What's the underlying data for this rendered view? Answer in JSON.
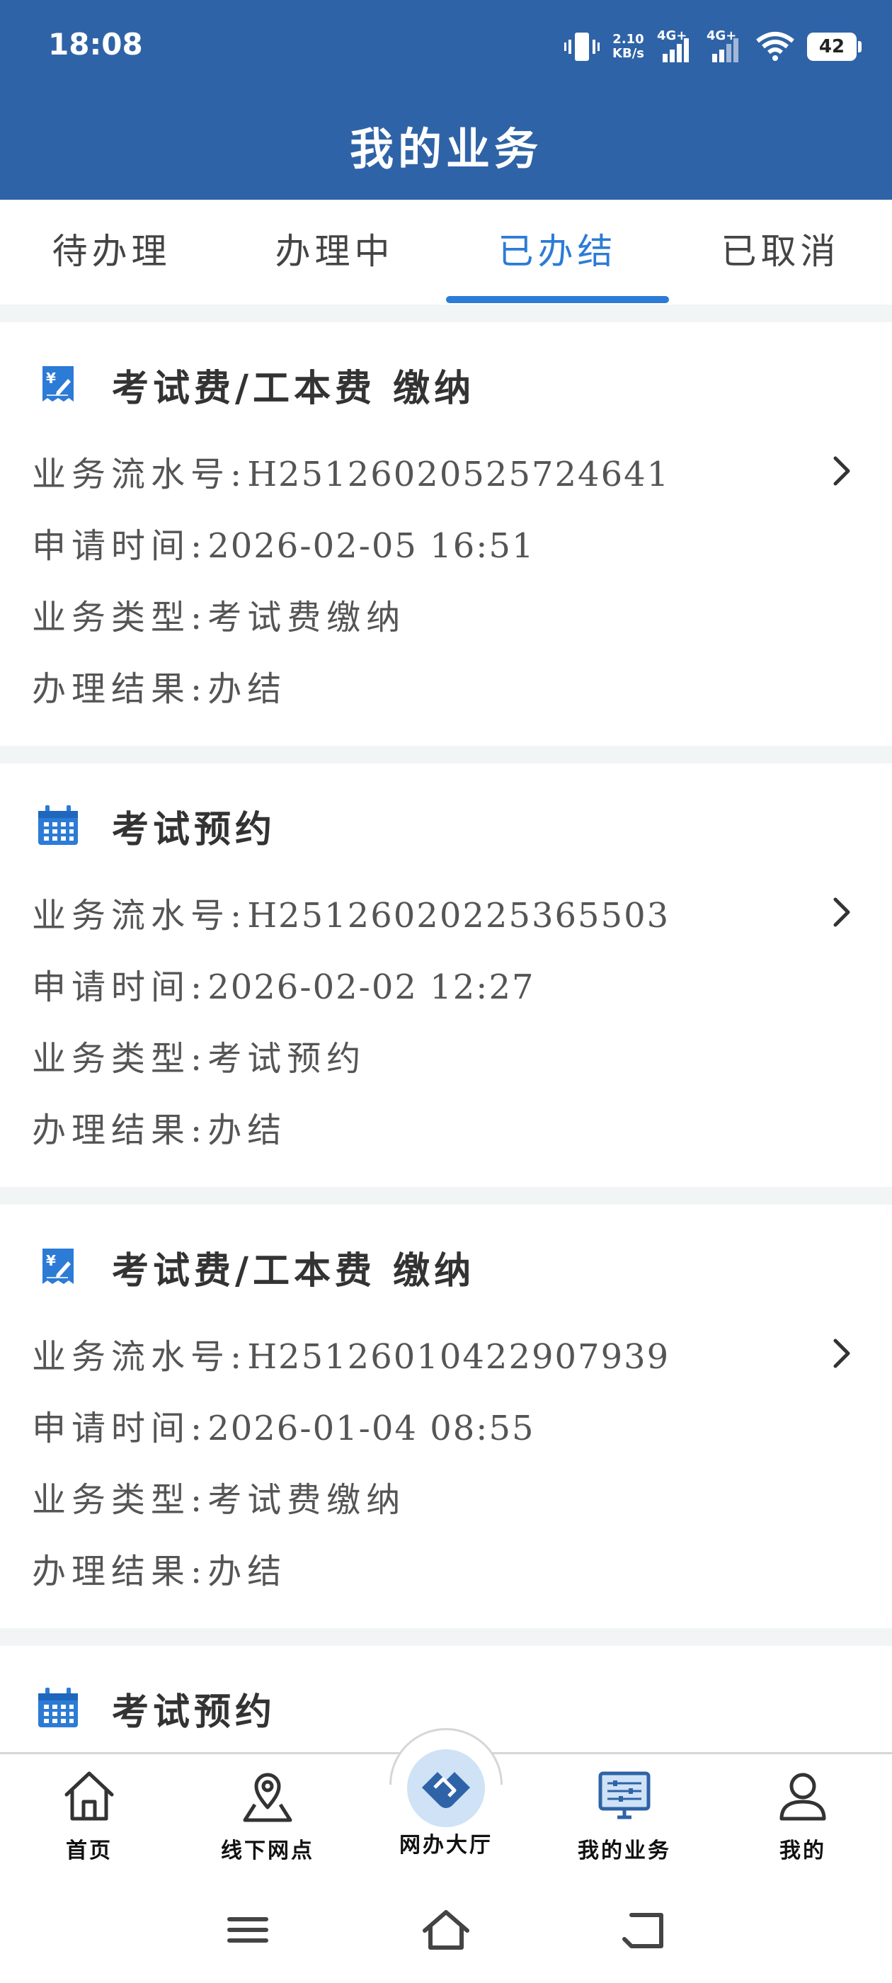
{
  "status": {
    "time": "18:08",
    "net_speed_value": "2.10",
    "net_speed_unit": "KB/s",
    "sim1": "4G+",
    "sim2": "4G+",
    "battery": "42"
  },
  "header": {
    "title": "我的业务"
  },
  "tabs": [
    {
      "label": "待办理",
      "active": false
    },
    {
      "label": "办理中",
      "active": false
    },
    {
      "label": "已办结",
      "active": true
    },
    {
      "label": "已取消",
      "active": false
    }
  ],
  "colors": {
    "header_bg": "#2f63a7",
    "accent": "#2c7bd6",
    "background": "#f2f5f6"
  },
  "labels": {
    "serial": "业务流水号:",
    "time": "申请时间:",
    "type": "业务类型:",
    "result": "办理结果:"
  },
  "cards": [
    {
      "icon": "receipt-icon",
      "title": "考试费/工本费 缴纳",
      "serial": "H25126020525724641",
      "time": "2026-02-05 16:51",
      "type": "考试费缴纳",
      "result": "办结"
    },
    {
      "icon": "calendar-icon",
      "title": "考试预约",
      "serial": "H25126020225365503",
      "time": "2026-02-02 12:27",
      "type": "考试预约",
      "result": "办结"
    },
    {
      "icon": "receipt-icon",
      "title": "考试费/工本费 缴纳",
      "serial": "H25126010422907939",
      "time": "2026-01-04 08:55",
      "type": "考试费缴纳",
      "result": "办结"
    },
    {
      "icon": "calendar-icon",
      "title": "考试预约"
    }
  ],
  "nav": [
    {
      "label": "首页",
      "icon": "home-icon"
    },
    {
      "label": "线下网点",
      "icon": "location-pin-icon"
    },
    {
      "label": "网办大厅",
      "icon": "handshake-icon"
    },
    {
      "label": "我的业务",
      "icon": "monitor-icon"
    },
    {
      "label": "我的",
      "icon": "person-icon"
    }
  ]
}
